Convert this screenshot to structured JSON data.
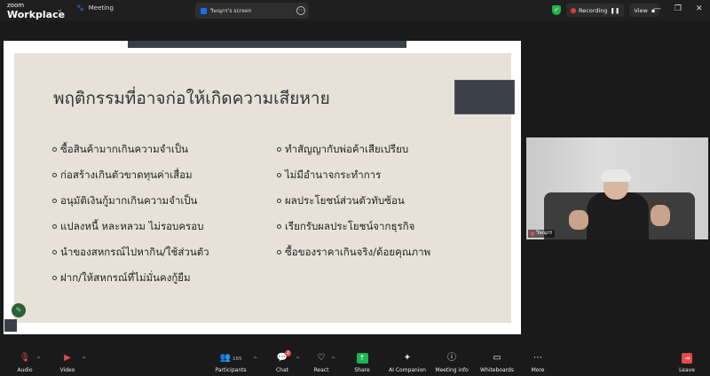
{
  "app": {
    "logo_line1": "zoom",
    "logo_line2": "Workplace"
  },
  "tabs": {
    "meeting_label": "Meeting",
    "screen_label": "วิษณุกร's screen"
  },
  "status": {
    "recording_label": "Recording",
    "view_label": "View"
  },
  "slide": {
    "title": "พฤติกรรมที่อาจก่อให้เกิดความเสียหาย",
    "left_bullets": [
      "ซื้อสินค้ามากเกินความจำเป็น",
      "ก่อสร้างเกินตัวขาดทุนค่าเสื่อม",
      "อนุมัติเงินกู้มากเกินความจำเป็น",
      "แปลงหนี้ หละหลวม ไม่รอบครอบ",
      "นำของสหกรณ์ไปหากิน/ใช้ส่วนตัว",
      "ฝาก/ให้สหกรณ์ที่ไม่มั่นคงกู้ยืม"
    ],
    "right_bullets": [
      "ทำสัญญากับพ่อค้าเสียเปรียบ",
      "ไม่มีอำนาจกระทำการ",
      "ผลประโยชน์ส่วนตัวทับซ้อน",
      "เรียกรับผลประโยชน์จากธุรกิจ",
      "ซื้อของราคาเกินจริง/ด้อยคุณภาพ"
    ]
  },
  "video": {
    "participant_name": "วิษณุกร"
  },
  "toolbar": {
    "audio": "Audio",
    "video": "Video",
    "participants": "Participants",
    "participants_count": "165",
    "chat": "Chat",
    "chat_badge": "2",
    "react": "React",
    "share": "Share",
    "ai_companion": "AI Companion",
    "meeting_info": "Meeting info",
    "whiteboards": "Whiteboards",
    "more": "More",
    "leave": "Leave"
  },
  "colors": {
    "recording": "#e0393e",
    "security": "#1fb34f",
    "share": "#1fb34f",
    "leave": "#e34b4b",
    "slide_bg": "#e6e2d7"
  }
}
